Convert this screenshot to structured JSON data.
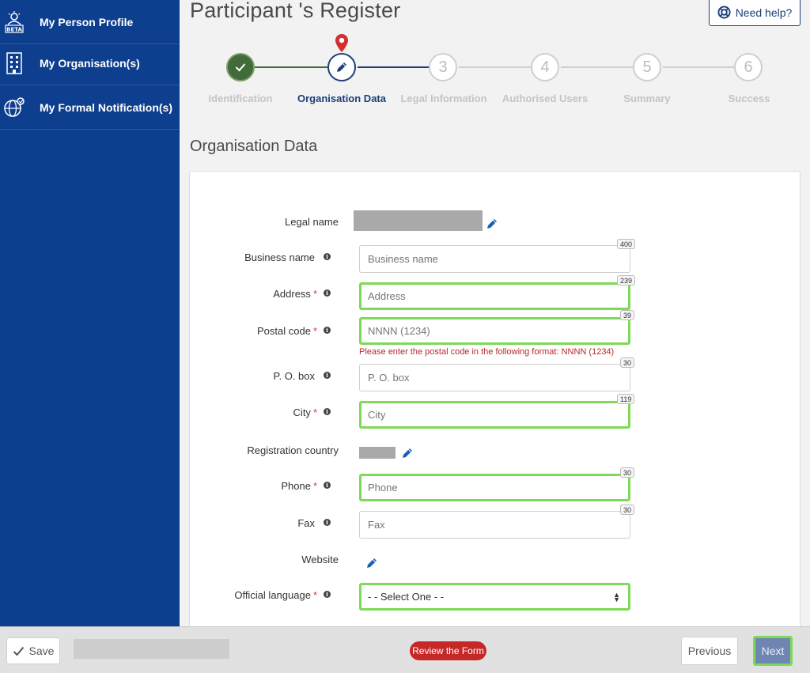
{
  "sidebar": {
    "items": [
      {
        "label": "My Person Profile",
        "icon": "beta-profile-icon"
      },
      {
        "label": "My Organisation(s)",
        "icon": "building-icon"
      },
      {
        "label": "My Formal Notification(s)",
        "icon": "globe-icon"
      }
    ],
    "beta_badge": "BETA"
  },
  "header": {
    "title": "Participant 's Register",
    "help_label": "Need help?"
  },
  "stepper": {
    "steps": [
      {
        "number": "",
        "label": "Identification",
        "state": "done"
      },
      {
        "number": "",
        "label": "Organisation Data",
        "state": "active"
      },
      {
        "number": "3",
        "label": "Legal Information",
        "state": "pending"
      },
      {
        "number": "4",
        "label": "Authorised Users",
        "state": "pending"
      },
      {
        "number": "5",
        "label": "Summary",
        "state": "pending"
      },
      {
        "number": "6",
        "label": "Success",
        "state": "pending"
      }
    ]
  },
  "section": {
    "title": "Organisation Data"
  },
  "form": {
    "legal_name": {
      "label": "Legal name"
    },
    "business_name": {
      "label": "Business name",
      "placeholder": "Business name",
      "counter": "400",
      "value": ""
    },
    "address": {
      "label": "Address",
      "required": "*",
      "placeholder": "Address",
      "counter": "239",
      "value": ""
    },
    "postal_code": {
      "label": "Postal code",
      "required": "*",
      "placeholder": "NNNN (1234)",
      "counter": "39",
      "value": "",
      "error": "Please enter the postal code in the following format: NNNN (1234)"
    },
    "po_box": {
      "label": "P. O. box",
      "placeholder": "P. O. box",
      "counter": "30",
      "value": ""
    },
    "city": {
      "label": "City",
      "required": "*",
      "placeholder": "City",
      "counter": "119",
      "value": ""
    },
    "registration_country": {
      "label": "Registration country"
    },
    "phone": {
      "label": "Phone",
      "required": "*",
      "placeholder": "Phone",
      "counter": "30",
      "value": ""
    },
    "fax": {
      "label": "Fax",
      "placeholder": "Fax",
      "counter": "30",
      "value": ""
    },
    "website": {
      "label": "Website"
    },
    "official_language": {
      "label": "Official language",
      "required": "*",
      "selected": "- - Select One - -"
    }
  },
  "footer": {
    "save_label": "Save",
    "review_label": "Review the Form",
    "previous_label": "Previous",
    "next_label": "Next"
  },
  "colors": {
    "sidebar_bg": "#0e3e8e",
    "primary": "#1b3f7a",
    "done_step": "#426b3a",
    "highlight": "#7ed957",
    "error": "#b8282a",
    "review_btn": "#c62828"
  }
}
